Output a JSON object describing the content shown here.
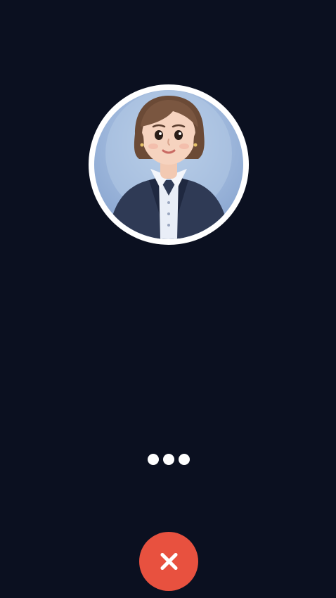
{
  "call_screen": {
    "avatar_label": "",
    "end_call_icon": "close-icon",
    "typing_dots": 3,
    "colors": {
      "background": "#0b1020",
      "end_call": "#e8513f",
      "ring": "#ffffff"
    }
  }
}
